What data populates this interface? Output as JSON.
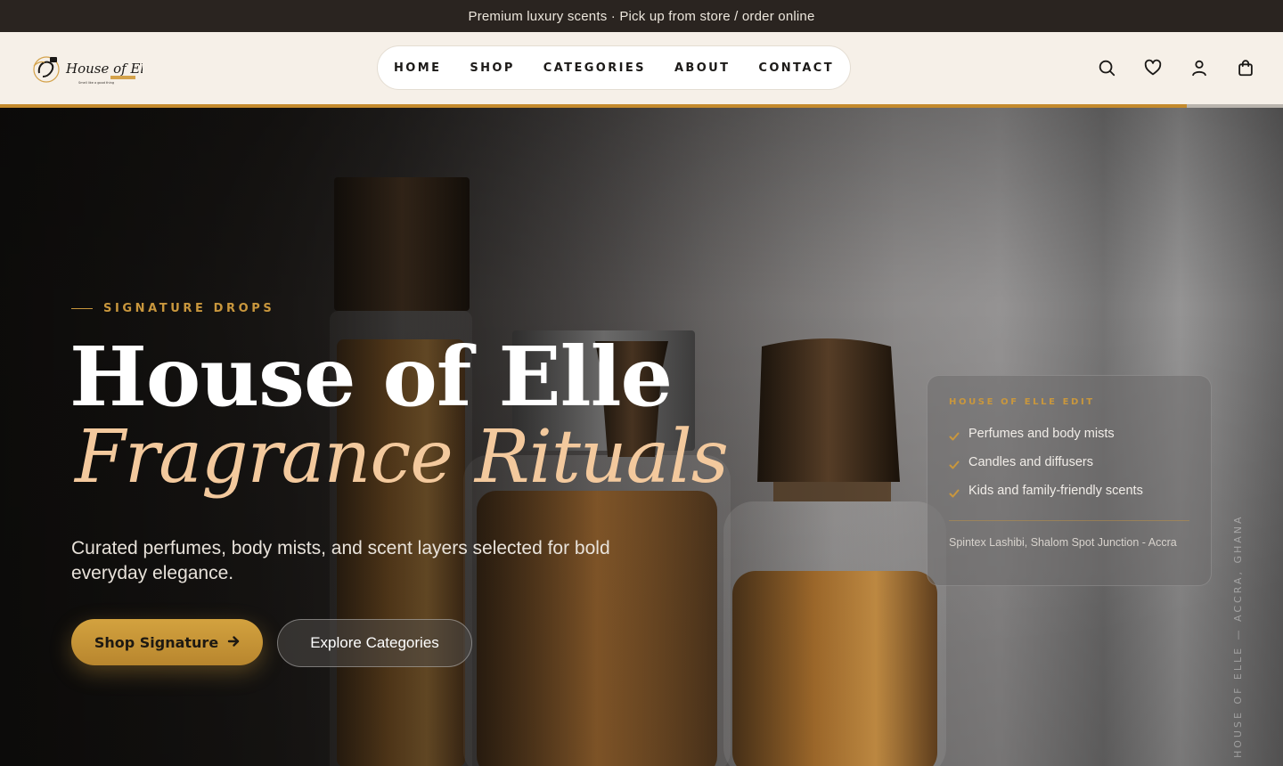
{
  "announcement": {
    "text": "Premium luxury scents · Pick up from store / order online"
  },
  "brand": {
    "name": "House of Elle",
    "tagline": "Smell like a good thing"
  },
  "nav": {
    "items": [
      {
        "label": "HOME"
      },
      {
        "label": "SHOP"
      },
      {
        "label": "CATEGORIES"
      },
      {
        "label": "ABOUT"
      },
      {
        "label": "CONTACT"
      }
    ]
  },
  "header_icons": [
    "search-icon",
    "heart-icon",
    "user-icon",
    "shopping-bag-icon"
  ],
  "scroll_progress": 0.925,
  "hero": {
    "eyebrow": "SIGNATURE DROPS",
    "title": "House of Elle",
    "script_title": "Fragrance Rituals",
    "subtitle": "Curated perfumes, body mists, and scent layers selected for bold everyday elegance.",
    "primary_cta": "Shop Signature",
    "secondary_cta": "Explore Categories",
    "vertical_caption": "HOUSE OF ELLE — ACCRA, GHANA"
  },
  "card": {
    "eyebrow": "HOUSE OF ELLE EDIT",
    "items": [
      "Perfumes and body mists",
      "Candles and diffusers",
      "Kids and family-friendly scents"
    ],
    "location": "Spintex Lashibi, Shalom Spot Junction - Accra"
  },
  "colors": {
    "accent_gold": "#c9973d",
    "script_peach": "#f3c99d",
    "header_bg": "#f6f0e8",
    "announce_bg": "#2a2420"
  }
}
